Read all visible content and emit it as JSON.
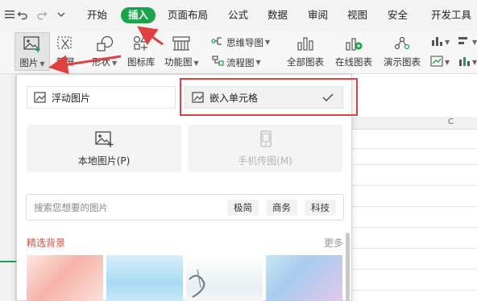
{
  "quick_access": [
    "app-menu-icon",
    "undo-icon",
    "redo-icon",
    "customize-dropdown-icon"
  ],
  "tabs": [
    {
      "id": "start",
      "label": "开始"
    },
    {
      "id": "insert",
      "label": "插入"
    },
    {
      "id": "layout",
      "label": "页面布局"
    },
    {
      "id": "formula",
      "label": "公式"
    },
    {
      "id": "data",
      "label": "数据"
    },
    {
      "id": "review",
      "label": "审阅"
    },
    {
      "id": "view",
      "label": "视图"
    },
    {
      "id": "security",
      "label": "安全"
    },
    {
      "id": "dev",
      "label": "开发工具"
    }
  ],
  "active_tab": "插入",
  "ribbon": {
    "picture": "图片",
    "screenshot": "截屏",
    "shapes": "形状",
    "icon_library": "图标库",
    "function_chart": "功能图",
    "mind_map": "思维导图",
    "flowchart": "流程图",
    "all_charts": "全部图表",
    "online_charts": "在线图表",
    "demo_charts": "演示图表"
  },
  "sheet": {
    "column_label": "C"
  },
  "panel": {
    "float_mode": "浮动图片",
    "embed_mode": "嵌入单元格",
    "local_picture": "本地图片(P)",
    "phone_picture": "手机传图(M)",
    "search_placeholder": "搜索您想要的图片",
    "tags": [
      "极简",
      "商务",
      "科技"
    ],
    "section_title": "精选背景",
    "more": "更多"
  },
  "colors": {
    "accent": "#1aa34a",
    "highlight": "#e0413e",
    "section": "#d9503f"
  }
}
